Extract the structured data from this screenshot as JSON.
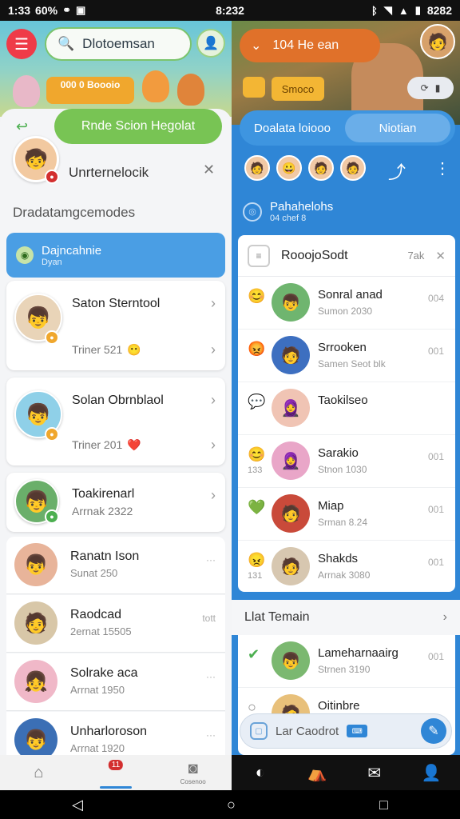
{
  "status_bar": {
    "time_left": "1:33",
    "carrier": "60%",
    "time_center": "8:232",
    "battery": "8282"
  },
  "left": {
    "search_placeholder": "Dlotoemsan",
    "promo_text": "000 0 Boooio",
    "banner_chip": "Rnde Scion Hegolat",
    "me_name": "Unrternelocik",
    "section_title": "Dradatamgcemodes",
    "active_item": {
      "title": "Dajncahnie",
      "sub": "Dyan"
    },
    "cards": [
      {
        "name": "Saton Sterntool",
        "sub": "Triner 521",
        "emoji": "😶"
      },
      {
        "name": "Solan Obrnblaol",
        "sub": "Triner 201",
        "emoji": "❤️"
      },
      {
        "name": "Toakirenarl",
        "sub": "Arrnak 2322"
      }
    ],
    "rows": [
      {
        "name": "Ranatn Ison",
        "sub": "Sunat 250",
        "meta": "···"
      },
      {
        "name": "Raodcad",
        "sub": "2ernat 15505",
        "meta": "tott"
      },
      {
        "name": "Solrake aca",
        "sub": "Arrnat 1950",
        "meta": "···"
      },
      {
        "name": "Unharloroson",
        "sub": "Arrnat 1920",
        "meta": "···"
      }
    ]
  },
  "right": {
    "video_label": "104 He ean",
    "live_tag": "Smoco",
    "tabs": [
      "Doalata loiooo",
      "Niotian"
    ],
    "group": {
      "title": "Pahahelohs",
      "sub": "04 chef 8"
    },
    "panel": {
      "title": "RooojoSodt",
      "extra": "7ak"
    },
    "chats": [
      {
        "name": "Sonral anad",
        "sub": "Sumon 2030",
        "meta": "004",
        "emo": "😊",
        "emonum": ""
      },
      {
        "name": "Srrooken",
        "sub": "Samen Seot blk",
        "meta": "001",
        "emo": "😡",
        "emonum": ""
      },
      {
        "name": "Taokilseo",
        "sub": "",
        "meta": "",
        "emo": "💬",
        "emonum": ""
      },
      {
        "name": "Sarakio",
        "sub": "Stnon 1030",
        "meta": "001",
        "emo": "😊",
        "emonum": "133"
      },
      {
        "name": "Miap",
        "sub": "Srman 8.24",
        "meta": "001",
        "emo": "💚",
        "emonum": ""
      },
      {
        "name": "Shakds",
        "sub": "Arrnak 3080",
        "meta": "001",
        "emo": "😠",
        "emonum": "131"
      }
    ],
    "list_header": "Llat Temain",
    "bottom_chats": [
      {
        "name": "Lameharnaairg",
        "sub": "Strnen 3190",
        "meta": "001"
      },
      {
        "name": "Oitinbre",
        "sub": "",
        "meta": ""
      }
    ],
    "compose_placeholder": "Lar Caodrot"
  },
  "tabbar": {
    "badge": "11",
    "left_label": "Cosenoo"
  }
}
